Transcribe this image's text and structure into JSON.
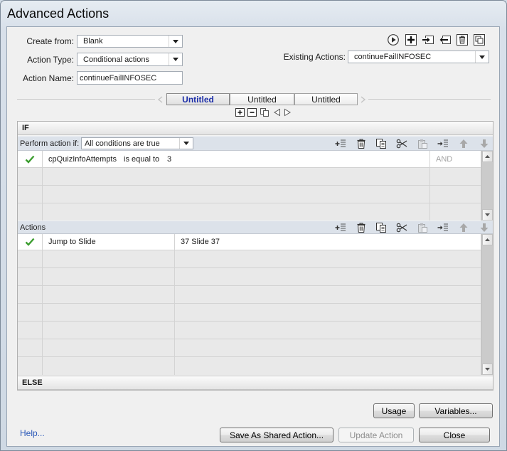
{
  "window": {
    "title": "Advanced Actions"
  },
  "form": {
    "create_from": {
      "label": "Create from:",
      "value": "Blank"
    },
    "action_type": {
      "label": "Action Type:",
      "value": "Conditional actions"
    },
    "action_name": {
      "label": "Action Name:",
      "value": "continueFailINFOSEC"
    },
    "existing_actions": {
      "label": "Existing Actions:",
      "value": "continueFailINFOSEC"
    }
  },
  "action_toolbar_icons": [
    "preview-icon",
    "add-action-icon",
    "import-action-icon",
    "export-action-icon",
    "delete-action-icon",
    "duplicate-action-icon"
  ],
  "decision_tabs": [
    {
      "label": "Untitled",
      "selected": true
    },
    {
      "label": "Untitled",
      "selected": false
    },
    {
      "label": "Untitled",
      "selected": false
    }
  ],
  "decision_control_icons": [
    "add-decision-icon",
    "remove-decision-icon",
    "duplicate-decision-icon",
    "previous-decision-icon",
    "next-decision-icon"
  ],
  "row_toolbar_icons": [
    "add-row-icon",
    "delete-row-icon",
    "copy-row-icon",
    "cut-row-icon",
    "paste-row-icon",
    "insert-row-icon",
    "move-up-icon",
    "move-down-icon"
  ],
  "if_block": {
    "header": "IF",
    "perform_label": "Perform action if:",
    "perform_value": "All conditions are true",
    "conditions": [
      {
        "enabled": true,
        "variable": "cpQuizInfoAttempts",
        "comparison": "is equal to",
        "value": "3",
        "logic": "AND"
      }
    ]
  },
  "actions_block": {
    "header": "Actions",
    "rows": [
      {
        "enabled": true,
        "action": "Jump to Slide",
        "target": "37 Slide 37"
      }
    ]
  },
  "else_block": {
    "header": "ELSE"
  },
  "footer": {
    "help": "Help...",
    "usage": "Usage",
    "variables": "Variables...",
    "save_shared": "Save As Shared Action...",
    "update": "Update Action",
    "update_enabled": false,
    "close": "Close"
  },
  "colors": {
    "selected_tab_text": "#1c2ea8",
    "help_link": "#2a58b8",
    "checkmark": "#3b9d2f",
    "section_bar": "#dce2ea",
    "disabled_text": "#8d8d8d"
  }
}
